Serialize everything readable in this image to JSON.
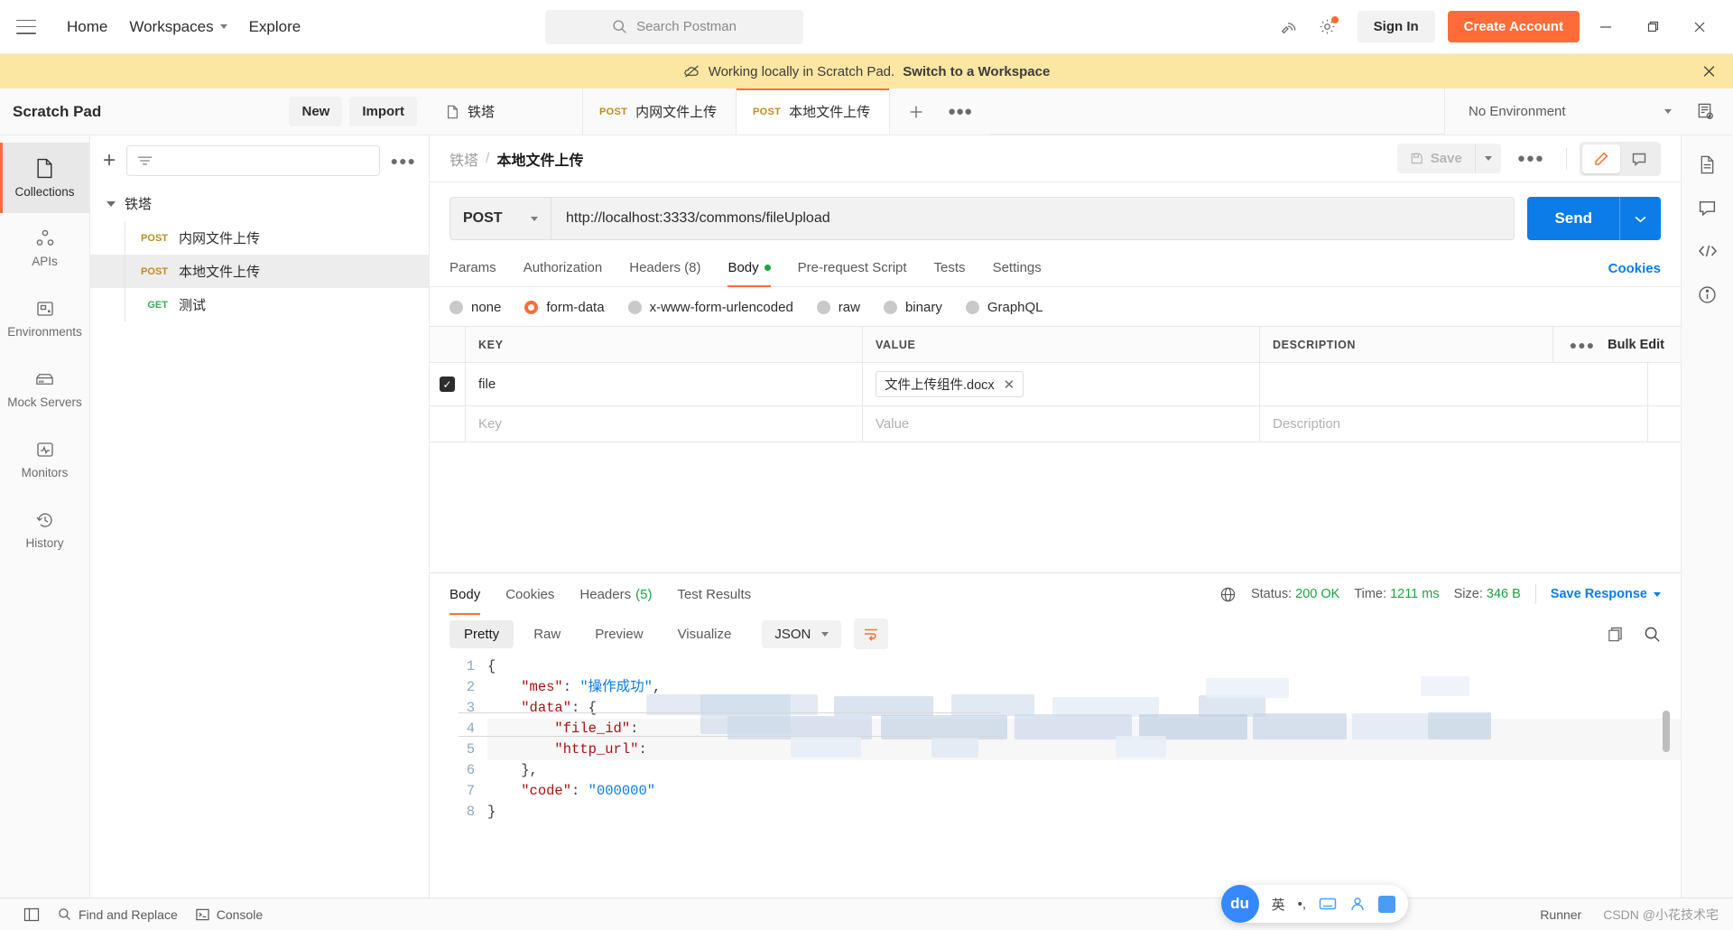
{
  "titlebar": {
    "menu_icon": "hamburger-icon",
    "home": "Home",
    "workspaces": "Workspaces",
    "explore": "Explore",
    "search_placeholder": "Search Postman",
    "sign_in": "Sign In",
    "create_account": "Create Account",
    "accent_orange": "#ff6c37"
  },
  "banner": {
    "text": "Working locally in Scratch Pad.",
    "link": "Switch to a Workspace",
    "bg": "#fbe6a2"
  },
  "scratchpad": {
    "title": "Scratch Pad",
    "new": "New",
    "import": "Import"
  },
  "tabs": [
    {
      "label": "铁塔",
      "method": "",
      "icon": "collection-icon",
      "active": false
    },
    {
      "label": "内网文件上传",
      "method": "POST",
      "icon": "",
      "active": false
    },
    {
      "label": "本地文件上传",
      "method": "POST",
      "icon": "",
      "active": true
    }
  ],
  "environment": {
    "selected": "No Environment"
  },
  "rail": [
    {
      "label": "Collections",
      "icon": "collections-icon",
      "active": true
    },
    {
      "label": "APIs",
      "icon": "apis-icon",
      "active": false
    },
    {
      "label": "Environments",
      "icon": "environments-icon",
      "active": false
    },
    {
      "label": "Mock Servers",
      "icon": "mock-servers-icon",
      "active": false
    },
    {
      "label": "Monitors",
      "icon": "monitors-icon",
      "active": false
    },
    {
      "label": "History",
      "icon": "history-icon",
      "active": false
    }
  ],
  "collections": {
    "filter_placeholder": "",
    "root": "铁塔",
    "items": [
      {
        "method": "POST",
        "name": "内网文件上传",
        "selected": false
      },
      {
        "method": "POST",
        "name": "本地文件上传",
        "selected": true
      },
      {
        "method": "GET",
        "name": "测试",
        "selected": false
      }
    ]
  },
  "request": {
    "breadcrumb_parent": "铁塔",
    "breadcrumb_sep": "/",
    "breadcrumb_current": "本地文件上传",
    "save_label": "Save",
    "method": "POST",
    "url": "http://localhost:3333/commons/fileUpload",
    "send_label": "Send",
    "cookies_link": "Cookies",
    "tabs": [
      {
        "label": "Params",
        "active": false,
        "dot": false
      },
      {
        "label": "Authorization",
        "active": false,
        "dot": false
      },
      {
        "label": "Headers (8)",
        "active": false,
        "dot": false
      },
      {
        "label": "Body",
        "active": true,
        "dot": true
      },
      {
        "label": "Pre-request Script",
        "active": false,
        "dot": false
      },
      {
        "label": "Tests",
        "active": false,
        "dot": false
      },
      {
        "label": "Settings",
        "active": false,
        "dot": false
      }
    ],
    "body_types": [
      {
        "label": "none",
        "selected": false
      },
      {
        "label": "form-data",
        "selected": true
      },
      {
        "label": "x-www-form-urlencoded",
        "selected": false
      },
      {
        "label": "raw",
        "selected": false
      },
      {
        "label": "binary",
        "selected": false
      },
      {
        "label": "GraphQL",
        "selected": false
      }
    ],
    "form_data": {
      "headers": {
        "key": "KEY",
        "value": "VALUE",
        "description": "DESCRIPTION"
      },
      "bulk_edit": "Bulk Edit",
      "rows": [
        {
          "checked": true,
          "key": "file",
          "value": "文件上传组件.docx",
          "value_is_file": true,
          "description": ""
        }
      ],
      "placeholders": {
        "key": "Key",
        "value": "Value",
        "description": "Description"
      }
    }
  },
  "response": {
    "tabs": [
      {
        "label": "Body",
        "active": true
      },
      {
        "label": "Cookies",
        "active": false
      },
      {
        "label": "Headers",
        "count": "(5)",
        "active": false
      },
      {
        "label": "Test Results",
        "active": false
      }
    ],
    "status_label": "Status:",
    "status_value": "200 OK",
    "time_label": "Time:",
    "time_value": "1211 ms",
    "size_label": "Size:",
    "size_value": "346 B",
    "save_response": "Save Response",
    "view_tabs": [
      {
        "label": "Pretty",
        "active": true
      },
      {
        "label": "Raw",
        "active": false
      },
      {
        "label": "Preview",
        "active": false
      },
      {
        "label": "Visualize",
        "active": false
      }
    ],
    "format": "JSON",
    "code_lines": [
      {
        "n": "1",
        "tokens": [
          {
            "t": "{",
            "c": "p"
          }
        ]
      },
      {
        "n": "2",
        "tokens": [
          {
            "t": "    ",
            "c": "p"
          },
          {
            "t": "\"mes\"",
            "c": "k"
          },
          {
            "t": ": ",
            "c": "p"
          },
          {
            "t": "\"操作成功\"",
            "c": "s"
          },
          {
            "t": ",",
            "c": "p"
          }
        ]
      },
      {
        "n": "3",
        "tokens": [
          {
            "t": "    ",
            "c": "p"
          },
          {
            "t": "\"data\"",
            "c": "k"
          },
          {
            "t": ": ",
            "c": "p"
          },
          {
            "t": "{",
            "c": "p"
          }
        ]
      },
      {
        "n": "4",
        "tokens": [
          {
            "t": "        ",
            "c": "p"
          },
          {
            "t": "\"file_id\"",
            "c": "k"
          },
          {
            "t": ": ",
            "c": "p"
          }
        ]
      },
      {
        "n": "5",
        "tokens": [
          {
            "t": "        ",
            "c": "p"
          },
          {
            "t": "\"http_url\"",
            "c": "k"
          },
          {
            "t": ": ",
            "c": "p"
          }
        ]
      },
      {
        "n": "6",
        "tokens": [
          {
            "t": "    ",
            "c": "p"
          },
          {
            "t": "},",
            "c": "p"
          }
        ]
      },
      {
        "n": "7",
        "tokens": [
          {
            "t": "    ",
            "c": "p"
          },
          {
            "t": "\"code\"",
            "c": "k"
          },
          {
            "t": ": ",
            "c": "p"
          },
          {
            "t": "\"000000\"",
            "c": "s"
          }
        ]
      },
      {
        "n": "8",
        "tokens": [
          {
            "t": "}",
            "c": "p"
          }
        ]
      }
    ]
  },
  "statusbar": {
    "find_replace": "Find and Replace",
    "console": "Console",
    "runner": "Runner",
    "watermark": "CSDN @小花技术宅"
  },
  "ime": {
    "logo": "du",
    "mode": "英"
  }
}
